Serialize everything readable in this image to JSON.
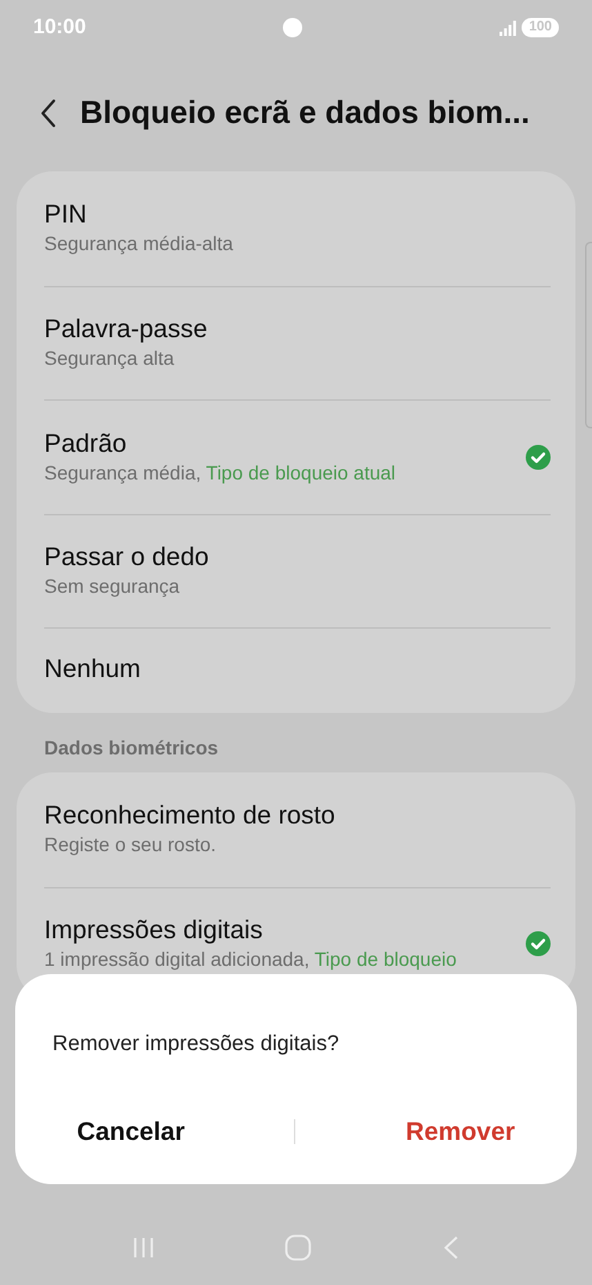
{
  "status_bar": {
    "time": "10:00",
    "battery": "100"
  },
  "header": {
    "title": "Bloqueio ecrã e dados biom..."
  },
  "lock_types": [
    {
      "title": "PIN",
      "subtitle": "Segurança média-alta",
      "checked": false
    },
    {
      "title": "Palavra-passe",
      "subtitle": "Segurança alta",
      "checked": false
    },
    {
      "title": "Padrão",
      "subtitle": "Segurança média,",
      "status": "Tipo de bloqueio atual",
      "checked": true
    },
    {
      "title": "Passar o dedo",
      "subtitle": "Sem segurança",
      "checked": false
    },
    {
      "title": "Nenhum",
      "checked": false
    }
  ],
  "biometrics": {
    "heading": "Dados biométricos",
    "items": [
      {
        "title": "Reconhecimento de rosto",
        "subtitle": "Registe o seu rosto.",
        "checked": false
      },
      {
        "title": "Impressões digitais",
        "subtitle": "1 impressão digital adicionada,",
        "status": "Tipo de bloqueio",
        "checked": true
      }
    ]
  },
  "dialog": {
    "message": "Remover impressões digitais?",
    "buttons": [
      {
        "label": "Cancelar",
        "kind": "cancel"
      },
      {
        "label": "Remover",
        "kind": "destructive"
      }
    ]
  }
}
